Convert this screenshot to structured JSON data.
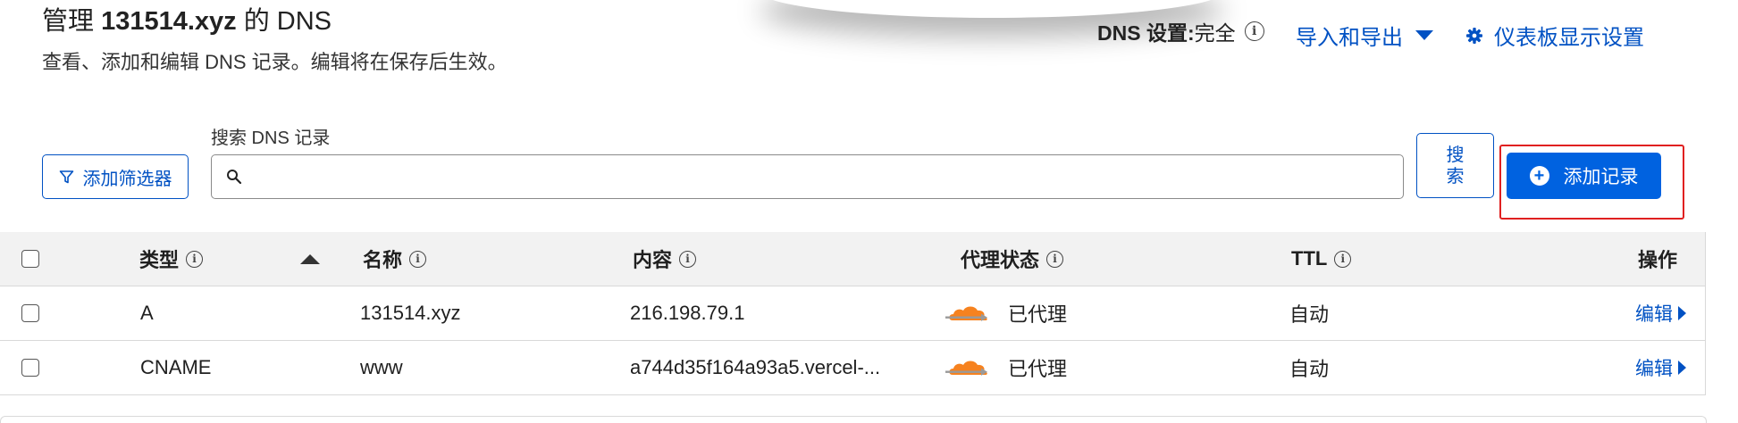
{
  "header": {
    "title_prefix": "管理 ",
    "title_domain": "131514.xyz",
    "title_suffix": " 的 DNS",
    "subtitle": "查看、添加和编辑 DNS 记录。编辑将在保存后生效。",
    "dns_setting_label": "DNS 设置:",
    "dns_setting_value": "完全",
    "import_export": "导入和导出",
    "dashboard_settings": "仪表板显示设置"
  },
  "toolbar": {
    "filter_label": "添加筛选器",
    "search_label": "搜索 DNS 记录",
    "search_value": "",
    "search_button": "搜索",
    "add_record": "添加记录"
  },
  "table": {
    "columns": {
      "type": "类型",
      "name": "名称",
      "content": "内容",
      "proxy": "代理状态",
      "ttl": "TTL",
      "actions": "操作"
    },
    "rows": [
      {
        "type": "A",
        "name": "131514.xyz",
        "content": "216.198.79.1",
        "proxy": "已代理",
        "ttl": "自动",
        "action": "编辑"
      },
      {
        "type": "CNAME",
        "name": "www",
        "content": "a744d35f164a93a5.vercel-...",
        "proxy": "已代理",
        "ttl": "自动",
        "action": "编辑"
      }
    ]
  },
  "colors": {
    "link_blue": "#0051c3",
    "primary_button": "#0062e0",
    "highlight_red": "#e02020",
    "cloud_orange": "#f6821f"
  },
  "icons": {
    "info": "info-icon",
    "filter": "funnel-icon",
    "search": "magnifier-icon",
    "add": "plus-circle-icon",
    "settings": "gear-icon",
    "proxy": "orange-cloud-icon"
  }
}
